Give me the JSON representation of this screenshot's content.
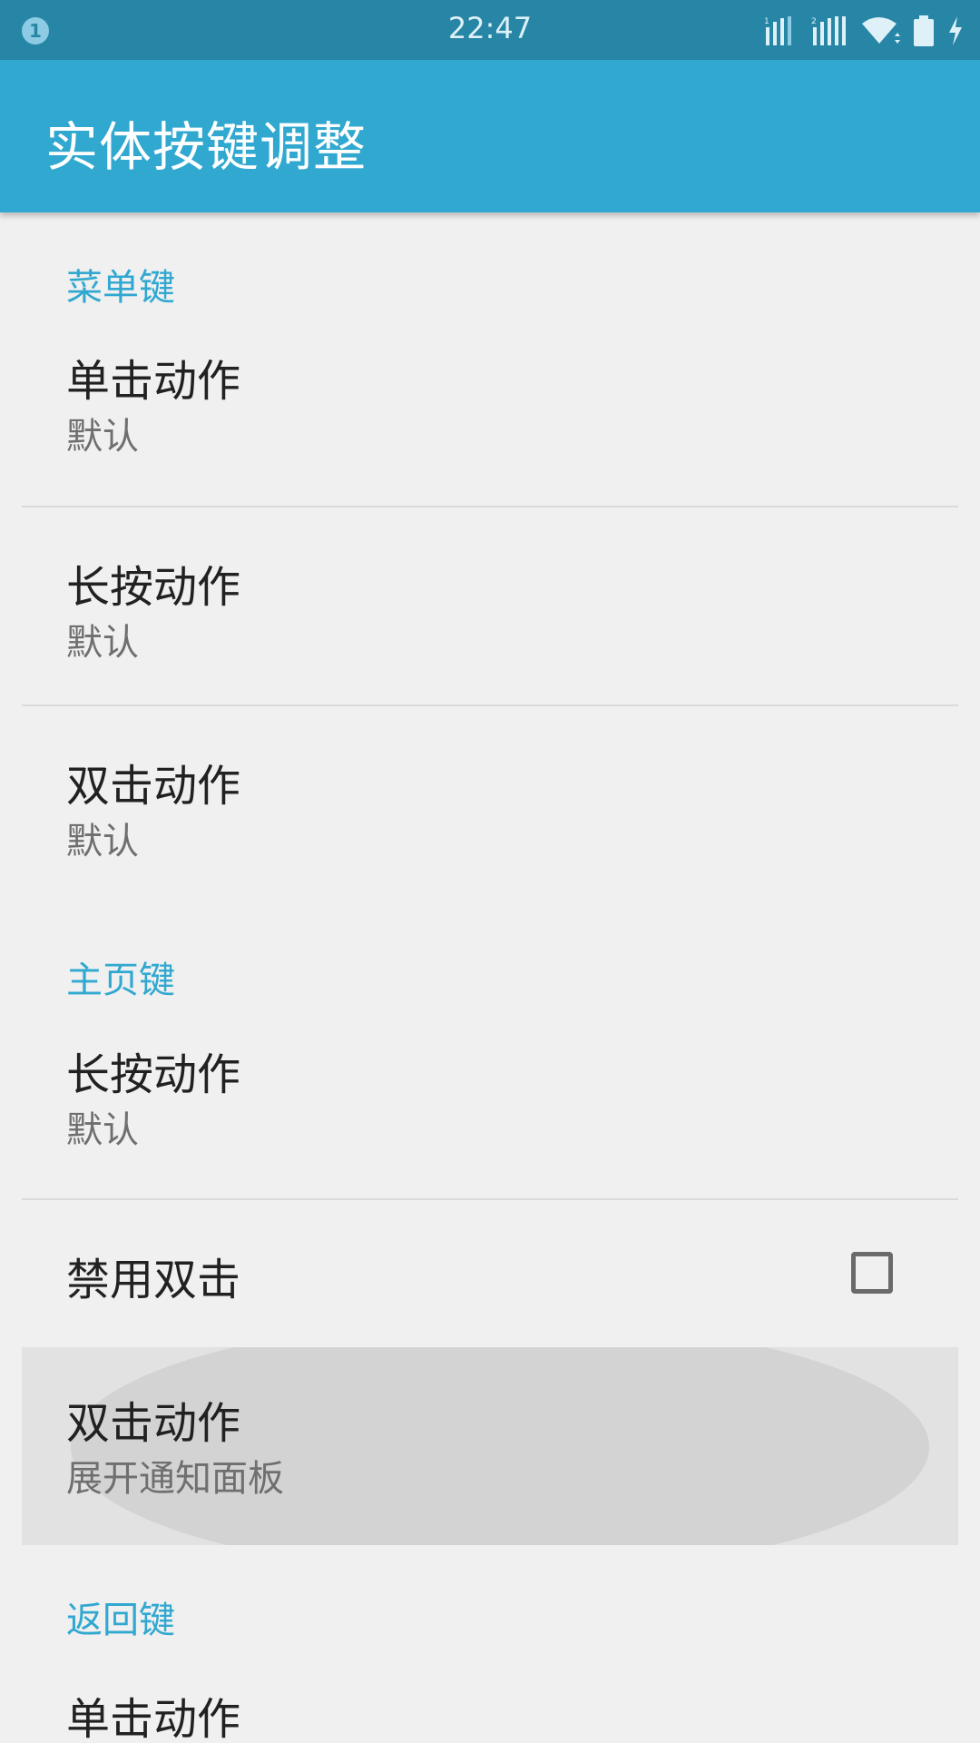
{
  "status_bar": {
    "notification_badge": "1",
    "time": "22:47",
    "icons": [
      "sim1-signal-icon",
      "sim2-signal-icon",
      "wifi-icon",
      "battery-icon",
      "charging-icon"
    ]
  },
  "app_bar": {
    "title": "实体按键调整"
  },
  "colors": {
    "accent": "#30a8d0",
    "status_bar": "#2786a6",
    "background": "#f0f0f0"
  },
  "sections": {
    "menu_key": {
      "header": "菜单键",
      "items": [
        {
          "title": "单击动作",
          "summary": "默认"
        },
        {
          "title": "长按动作",
          "summary": "默认"
        },
        {
          "title": "双击动作",
          "summary": "默认"
        }
      ]
    },
    "home_key": {
      "header": "主页键",
      "items": [
        {
          "title": "长按动作",
          "summary": "默认"
        },
        {
          "title": "禁用双击",
          "checked": false
        },
        {
          "title": "双击动作",
          "summary": "展开通知面板"
        }
      ]
    },
    "back_key": {
      "header": "返回键",
      "items": [
        {
          "title": "单击动作"
        }
      ]
    }
  }
}
